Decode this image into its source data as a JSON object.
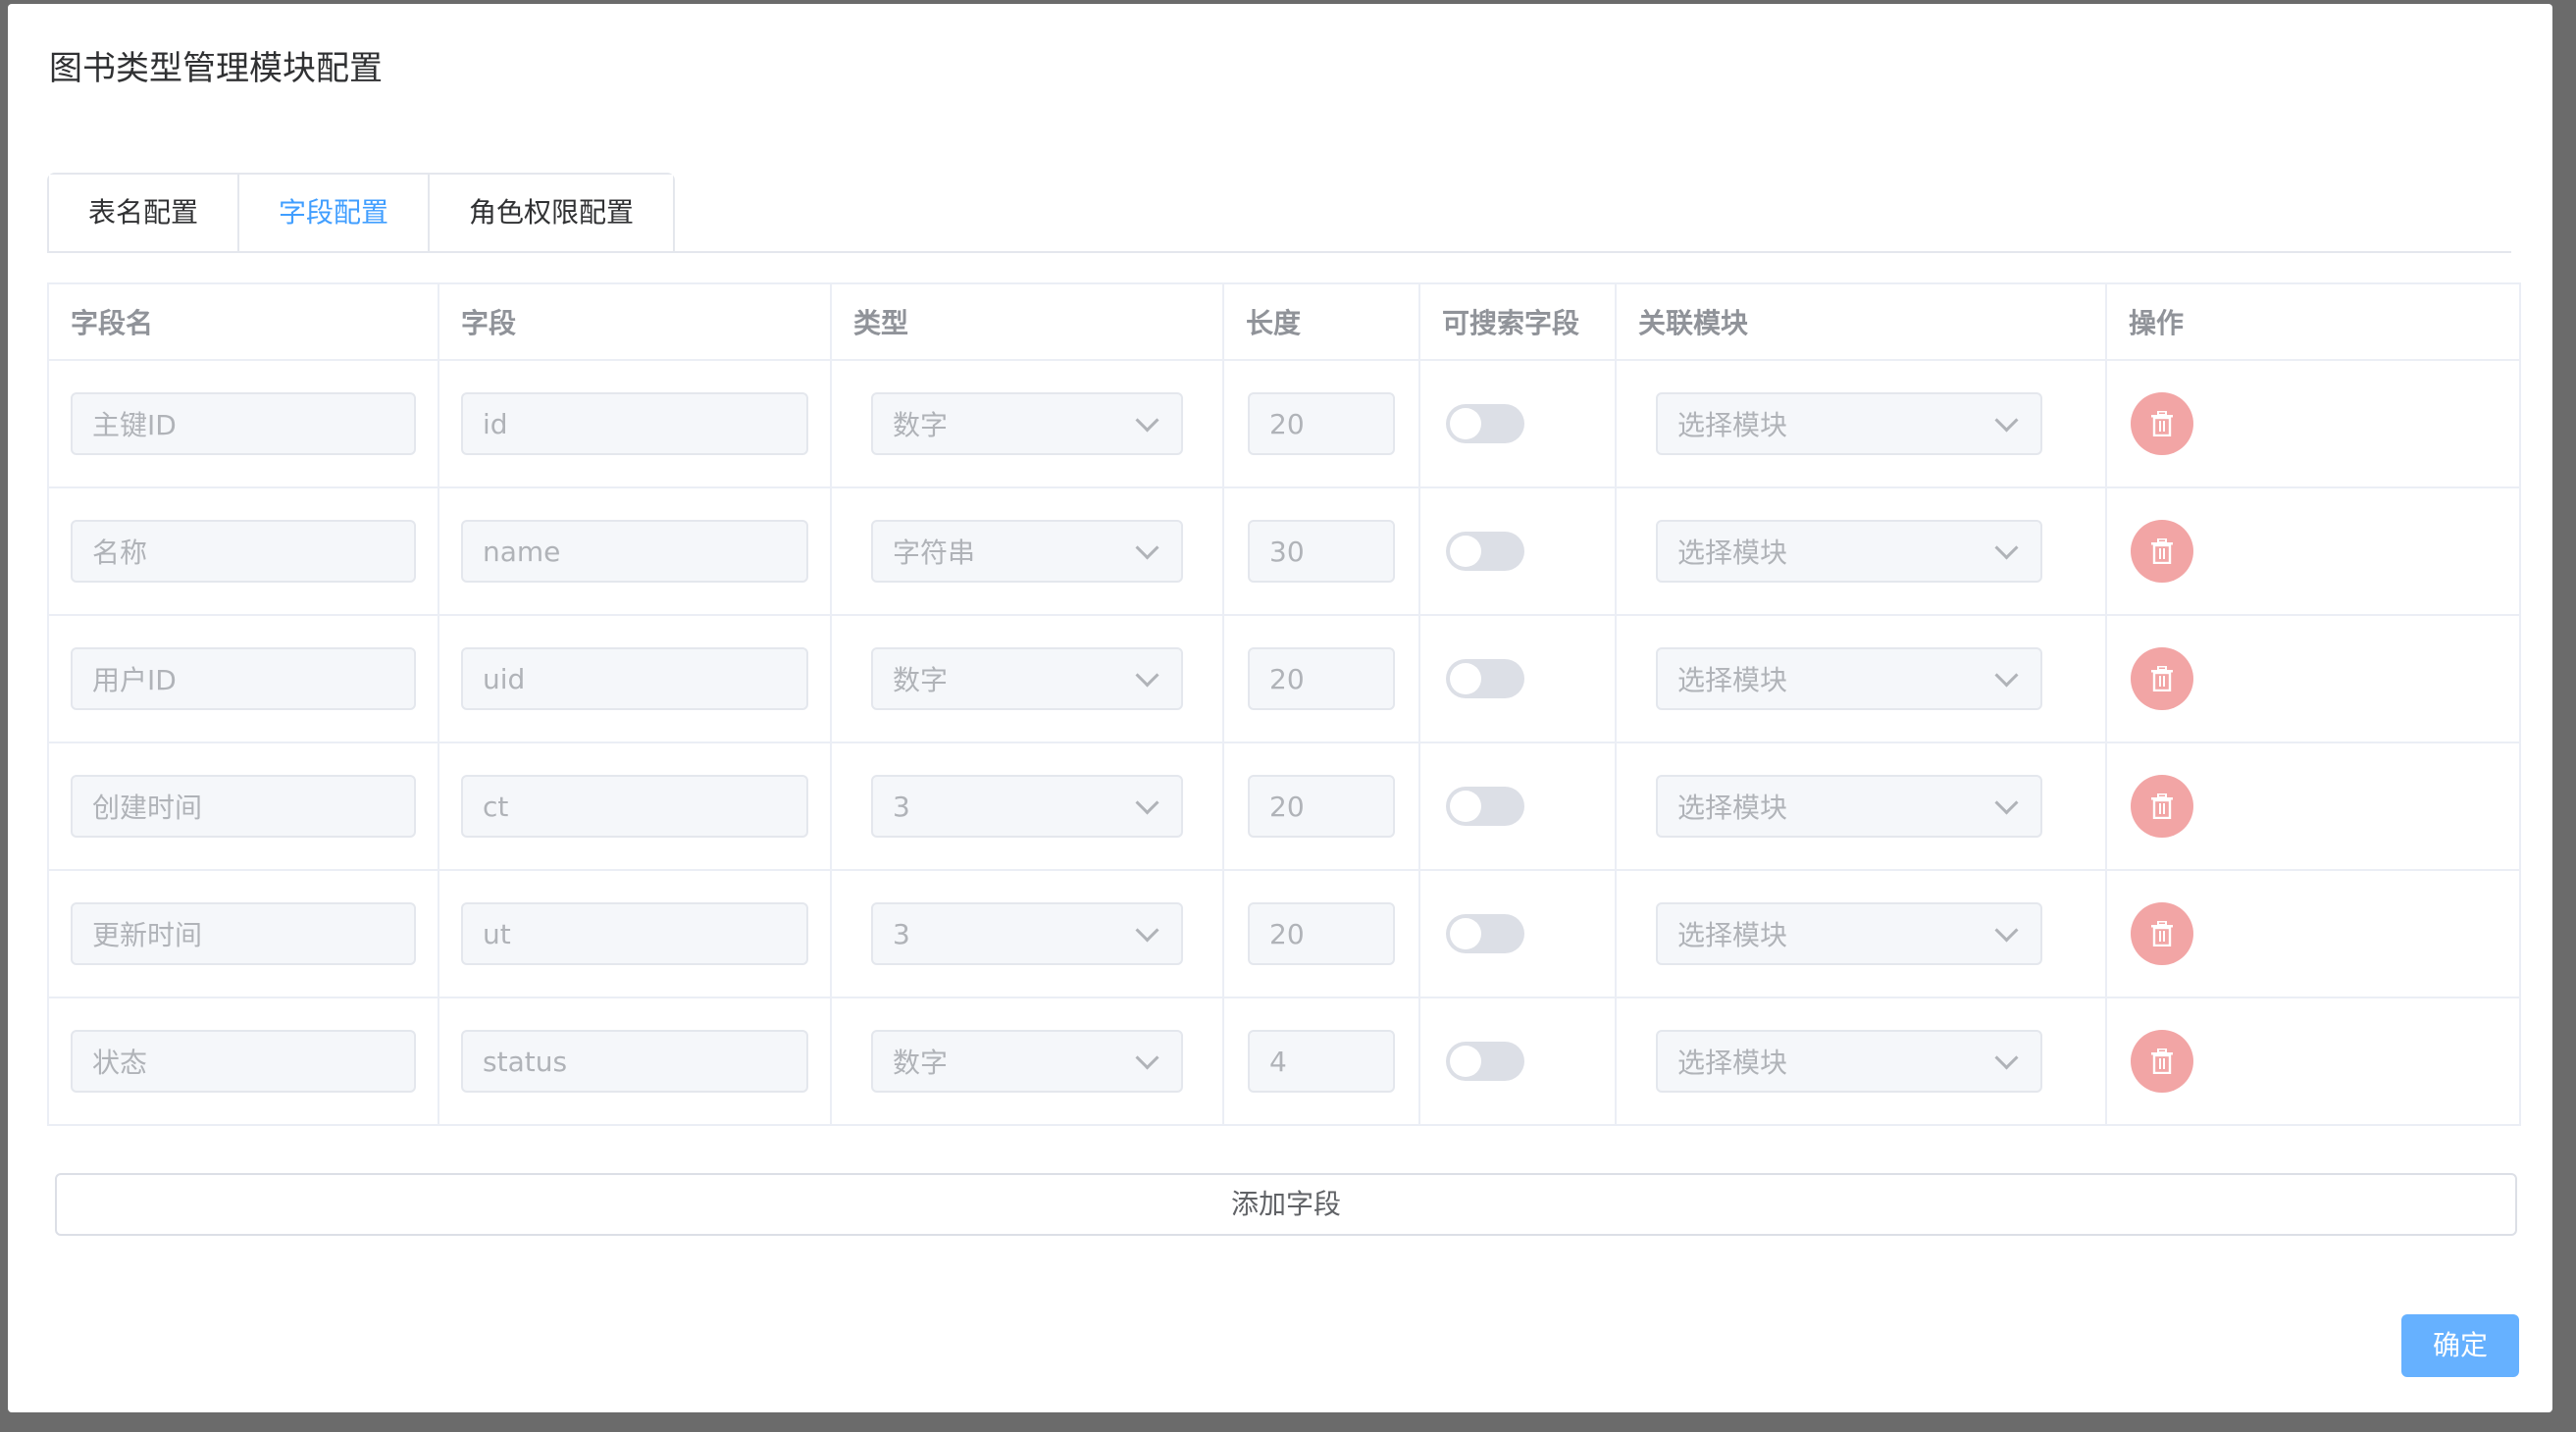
{
  "dialog": {
    "title": "图书类型管理模块配置"
  },
  "tabs": [
    {
      "label": "表名配置",
      "active": false
    },
    {
      "label": "字段配置",
      "active": true
    },
    {
      "label": "角色权限配置",
      "active": false
    }
  ],
  "table": {
    "headers": [
      "字段名",
      "字段",
      "类型",
      "长度",
      "可搜索字段",
      "关联模块",
      "操作"
    ],
    "rows": [
      {
        "name": "主键ID",
        "field": "id",
        "type": "数字",
        "length": "20",
        "searchable": false,
        "module": "选择模块"
      },
      {
        "name": "名称",
        "field": "name",
        "type": "字符串",
        "length": "30",
        "searchable": false,
        "module": "选择模块"
      },
      {
        "name": "用户ID",
        "field": "uid",
        "type": "数字",
        "length": "20",
        "searchable": false,
        "module": "选择模块"
      },
      {
        "name": "创建时间",
        "field": "ct",
        "type": "3",
        "length": "20",
        "searchable": false,
        "module": "选择模块"
      },
      {
        "name": "更新时间",
        "field": "ut",
        "type": "3",
        "length": "20",
        "searchable": false,
        "module": "选择模块"
      },
      {
        "name": "状态",
        "field": "status",
        "type": "数字",
        "length": "4",
        "searchable": false,
        "module": "选择模块"
      }
    ]
  },
  "buttons": {
    "add_field": "添加字段",
    "confirm": "确定"
  },
  "colors": {
    "accent": "#409eff",
    "delete": "#f2a5a5",
    "confirm": "#66b1ff"
  },
  "icons": {
    "delete": "trash-icon",
    "dropdown": "chevron-down-icon"
  }
}
